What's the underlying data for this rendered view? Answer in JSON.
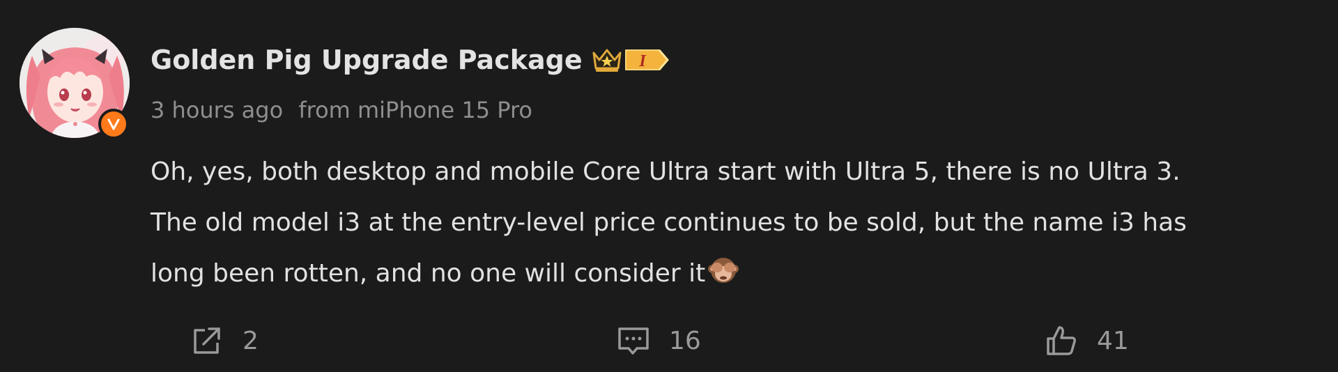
{
  "post": {
    "username": "Golden Pig Upgrade Package",
    "level_badge": "I",
    "time": "3 hours ago",
    "source": "from miPhone 15 Pro",
    "content_lines": [
      "Oh, yes, both desktop and mobile Core Ultra start with Ultra 5, there is no Ultra 3.",
      "The old model i3 at the entry-level price continues to be sold, but the name i3 has",
      "long been rotten, and no one will consider it"
    ],
    "emoji": "see-no-evil-monkey",
    "verified_badge": "V"
  },
  "actions": {
    "repost_count": "2",
    "comment_count": "16",
    "like_count": "41"
  },
  "icons": {
    "repost": "share-out-icon",
    "comment": "comment-icon",
    "like": "thumbs-up-icon",
    "crown": "crown-icon",
    "verified": "verified-v-icon"
  },
  "colors": {
    "background": "#1b1b1b",
    "text_primary": "#e2e2e2",
    "text_secondary": "#8f8f8f",
    "verified_orange": "#ff7a1a",
    "badge_gold": "#f3b33d"
  }
}
